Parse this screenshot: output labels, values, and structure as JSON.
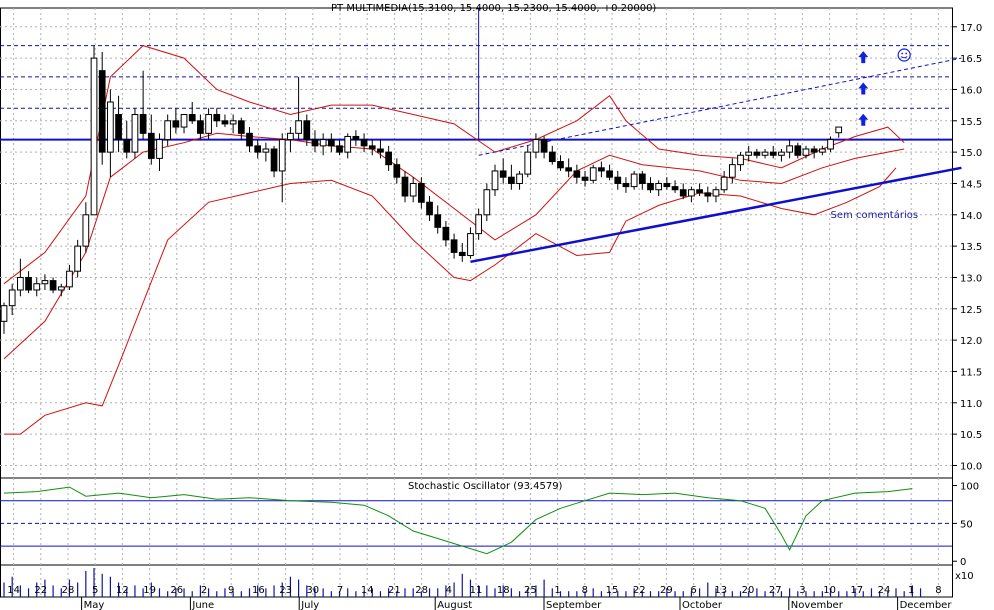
{
  "chart_data": {
    "type": "candlestick",
    "title": "PT MULTIMEDIA(15.3100, 15.4000, 15.2300, 15.4000, +0.20000)",
    "price_axis": {
      "ylim": [
        9.8,
        17.3
      ],
      "ticks": [
        10.0,
        10.5,
        11.0,
        11.5,
        12.0,
        12.5,
        13.0,
        13.5,
        14.0,
        14.5,
        15.0,
        15.5,
        16.0,
        16.5,
        17.0
      ],
      "tick_labels": [
        "10.0",
        "10.5",
        "11.0",
        "11.5",
        "12.0",
        "12.5",
        "13.0",
        "13.5",
        "14.0",
        "14.5",
        "15.0",
        "15.5",
        "16.0",
        "16.5",
        "17.0"
      ],
      "grid": true
    },
    "x_axis": {
      "day_labels": [
        "14",
        "22",
        "28",
        "5",
        "12",
        "19",
        "26",
        "2",
        "9",
        "16",
        "23",
        "30",
        "7",
        "14",
        "21",
        "28",
        "4",
        "11",
        "18",
        "25",
        "1",
        "8",
        "15",
        "22",
        "29",
        "6",
        "13",
        "20",
        "27",
        "3",
        "10",
        "17",
        "24",
        "1",
        "8"
      ],
      "month_labels": [
        {
          "label": "May",
          "at": 3
        },
        {
          "label": "June",
          "at": 7
        },
        {
          "label": "July",
          "at": 11
        },
        {
          "label": "August",
          "at": 16
        },
        {
          "label": "September",
          "at": 20
        },
        {
          "label": "October",
          "at": 25
        },
        {
          "label": "November",
          "at": 29
        },
        {
          "label": "December",
          "at": 33
        }
      ]
    },
    "candles": [
      {
        "o": 12.3,
        "h": 12.6,
        "l": 12.1,
        "c": 12.55
      },
      {
        "o": 12.55,
        "h": 12.9,
        "l": 12.4,
        "c": 12.8
      },
      {
        "o": 12.8,
        "h": 13.3,
        "l": 12.7,
        "c": 13.0
      },
      {
        "o": 13.0,
        "h": 13.1,
        "l": 12.75,
        "c": 12.8
      },
      {
        "o": 12.8,
        "h": 13.0,
        "l": 12.7,
        "c": 12.9
      },
      {
        "o": 12.9,
        "h": 13.05,
        "l": 12.8,
        "c": 12.95
      },
      {
        "o": 12.95,
        "h": 13.0,
        "l": 12.75,
        "c": 12.8
      },
      {
        "o": 12.8,
        "h": 12.9,
        "l": 12.7,
        "c": 12.85
      },
      {
        "o": 12.85,
        "h": 13.2,
        "l": 12.8,
        "c": 13.1
      },
      {
        "o": 13.1,
        "h": 13.6,
        "l": 13.0,
        "c": 13.5
      },
      {
        "o": 13.5,
        "h": 14.2,
        "l": 13.4,
        "c": 14.0
      },
      {
        "o": 14.0,
        "h": 16.7,
        "l": 14.0,
        "c": 16.5
      },
      {
        "o": 16.3,
        "h": 16.6,
        "l": 14.8,
        "c": 15.0
      },
      {
        "o": 15.0,
        "h": 16.0,
        "l": 14.6,
        "c": 15.8
      },
      {
        "o": 15.6,
        "h": 15.9,
        "l": 15.0,
        "c": 15.2
      },
      {
        "o": 15.2,
        "h": 15.5,
        "l": 14.9,
        "c": 15.0
      },
      {
        "o": 15.0,
        "h": 15.7,
        "l": 14.9,
        "c": 15.6
      },
      {
        "o": 15.6,
        "h": 16.3,
        "l": 15.2,
        "c": 15.3
      },
      {
        "o": 15.3,
        "h": 15.6,
        "l": 14.8,
        "c": 14.9
      },
      {
        "o": 14.9,
        "h": 15.3,
        "l": 14.7,
        "c": 15.2
      },
      {
        "o": 15.2,
        "h": 15.6,
        "l": 15.1,
        "c": 15.5
      },
      {
        "o": 15.5,
        "h": 15.7,
        "l": 15.3,
        "c": 15.4
      },
      {
        "o": 15.4,
        "h": 15.6,
        "l": 15.3,
        "c": 15.6
      },
      {
        "o": 15.6,
        "h": 15.8,
        "l": 15.45,
        "c": 15.5
      },
      {
        "o": 15.5,
        "h": 15.6,
        "l": 15.2,
        "c": 15.3
      },
      {
        "o": 15.3,
        "h": 15.7,
        "l": 15.2,
        "c": 15.6
      },
      {
        "o": 15.6,
        "h": 15.7,
        "l": 15.4,
        "c": 15.5
      },
      {
        "o": 15.5,
        "h": 15.6,
        "l": 15.4,
        "c": 15.45
      },
      {
        "o": 15.45,
        "h": 15.6,
        "l": 15.3,
        "c": 15.5
      },
      {
        "o": 15.5,
        "h": 15.55,
        "l": 15.2,
        "c": 15.3
      },
      {
        "o": 15.3,
        "h": 15.4,
        "l": 15.0,
        "c": 15.1
      },
      {
        "o": 15.1,
        "h": 15.2,
        "l": 14.9,
        "c": 15.0
      },
      {
        "o": 15.0,
        "h": 15.15,
        "l": 14.85,
        "c": 15.05
      },
      {
        "o": 15.05,
        "h": 15.1,
        "l": 14.6,
        "c": 14.7
      },
      {
        "o": 14.7,
        "h": 15.3,
        "l": 14.2,
        "c": 15.2
      },
      {
        "o": 15.2,
        "h": 15.4,
        "l": 15.0,
        "c": 15.3
      },
      {
        "o": 15.3,
        "h": 16.2,
        "l": 15.2,
        "c": 15.5
      },
      {
        "o": 15.5,
        "h": 15.6,
        "l": 15.1,
        "c": 15.2
      },
      {
        "o": 15.2,
        "h": 15.35,
        "l": 15.0,
        "c": 15.1
      },
      {
        "o": 15.1,
        "h": 15.3,
        "l": 14.95,
        "c": 15.2
      },
      {
        "o": 15.2,
        "h": 15.3,
        "l": 15.0,
        "c": 15.1
      },
      {
        "o": 15.1,
        "h": 15.2,
        "l": 14.95,
        "c": 15.0
      },
      {
        "o": 15.0,
        "h": 15.3,
        "l": 14.9,
        "c": 15.25
      },
      {
        "o": 15.25,
        "h": 15.35,
        "l": 15.1,
        "c": 15.2
      },
      {
        "o": 15.2,
        "h": 15.3,
        "l": 15.0,
        "c": 15.1
      },
      {
        "o": 15.1,
        "h": 15.2,
        "l": 14.95,
        "c": 15.05
      },
      {
        "o": 15.05,
        "h": 15.2,
        "l": 14.9,
        "c": 15.0
      },
      {
        "o": 15.0,
        "h": 15.1,
        "l": 14.7,
        "c": 14.8
      },
      {
        "o": 14.8,
        "h": 14.9,
        "l": 14.5,
        "c": 14.6
      },
      {
        "o": 14.6,
        "h": 14.7,
        "l": 14.2,
        "c": 14.3
      },
      {
        "o": 14.3,
        "h": 14.6,
        "l": 14.2,
        "c": 14.5
      },
      {
        "o": 14.5,
        "h": 14.6,
        "l": 14.1,
        "c": 14.2
      },
      {
        "o": 14.2,
        "h": 14.3,
        "l": 13.9,
        "c": 14.0
      },
      {
        "o": 14.0,
        "h": 14.15,
        "l": 13.7,
        "c": 13.8
      },
      {
        "o": 13.8,
        "h": 13.9,
        "l": 13.5,
        "c": 13.6
      },
      {
        "o": 13.6,
        "h": 13.7,
        "l": 13.3,
        "c": 13.4
      },
      {
        "o": 13.4,
        "h": 13.55,
        "l": 13.25,
        "c": 13.35
      },
      {
        "o": 13.35,
        "h": 13.8,
        "l": 13.3,
        "c": 13.7
      },
      {
        "o": 13.7,
        "h": 14.1,
        "l": 13.6,
        "c": 14.0
      },
      {
        "o": 14.0,
        "h": 14.5,
        "l": 13.9,
        "c": 14.4
      },
      {
        "o": 14.4,
        "h": 14.8,
        "l": 14.3,
        "c": 14.7
      },
      {
        "o": 14.7,
        "h": 14.9,
        "l": 14.5,
        "c": 14.6
      },
      {
        "o": 14.6,
        "h": 14.8,
        "l": 14.4,
        "c": 14.5
      },
      {
        "o": 14.5,
        "h": 14.7,
        "l": 14.4,
        "c": 14.65
      },
      {
        "o": 14.65,
        "h": 15.1,
        "l": 14.6,
        "c": 15.0
      },
      {
        "o": 15.0,
        "h": 15.3,
        "l": 14.9,
        "c": 15.2
      },
      {
        "o": 15.2,
        "h": 15.25,
        "l": 14.9,
        "c": 15.0
      },
      {
        "o": 15.0,
        "h": 15.1,
        "l": 14.8,
        "c": 14.85
      },
      {
        "o": 14.85,
        "h": 14.95,
        "l": 14.7,
        "c": 14.75
      },
      {
        "o": 14.75,
        "h": 14.9,
        "l": 14.6,
        "c": 14.7
      },
      {
        "o": 14.7,
        "h": 14.8,
        "l": 14.5,
        "c": 14.6
      },
      {
        "o": 14.6,
        "h": 14.7,
        "l": 14.45,
        "c": 14.55
      },
      {
        "o": 14.55,
        "h": 14.8,
        "l": 14.5,
        "c": 14.75
      },
      {
        "o": 14.75,
        "h": 14.85,
        "l": 14.6,
        "c": 14.7
      },
      {
        "o": 14.7,
        "h": 14.8,
        "l": 14.55,
        "c": 14.6
      },
      {
        "o": 14.6,
        "h": 14.7,
        "l": 14.4,
        "c": 14.5
      },
      {
        "o": 14.5,
        "h": 14.6,
        "l": 14.35,
        "c": 14.45
      },
      {
        "o": 14.45,
        "h": 14.7,
        "l": 14.4,
        "c": 14.65
      },
      {
        "o": 14.65,
        "h": 14.7,
        "l": 14.4,
        "c": 14.5
      },
      {
        "o": 14.5,
        "h": 14.6,
        "l": 14.35,
        "c": 14.4
      },
      {
        "o": 14.4,
        "h": 14.55,
        "l": 14.3,
        "c": 14.5
      },
      {
        "o": 14.5,
        "h": 14.6,
        "l": 14.4,
        "c": 14.45
      },
      {
        "o": 14.45,
        "h": 14.55,
        "l": 14.35,
        "c": 14.4
      },
      {
        "o": 14.4,
        "h": 14.5,
        "l": 14.25,
        "c": 14.3
      },
      {
        "o": 14.3,
        "h": 14.45,
        "l": 14.2,
        "c": 14.4
      },
      {
        "o": 14.4,
        "h": 14.5,
        "l": 14.3,
        "c": 14.35
      },
      {
        "o": 14.35,
        "h": 14.45,
        "l": 14.2,
        "c": 14.3
      },
      {
        "o": 14.3,
        "h": 14.45,
        "l": 14.2,
        "c": 14.4
      },
      {
        "o": 14.4,
        "h": 14.7,
        "l": 14.35,
        "c": 14.6
      },
      {
        "o": 14.6,
        "h": 14.9,
        "l": 14.5,
        "c": 14.8
      },
      {
        "o": 14.8,
        "h": 15.0,
        "l": 14.7,
        "c": 14.95
      },
      {
        "o": 14.95,
        "h": 15.1,
        "l": 14.85,
        "c": 15.0
      },
      {
        "o": 15.0,
        "h": 15.05,
        "l": 14.9,
        "c": 14.95
      },
      {
        "o": 14.95,
        "h": 15.05,
        "l": 14.9,
        "c": 15.0
      },
      {
        "o": 15.0,
        "h": 15.1,
        "l": 14.9,
        "c": 14.95
      },
      {
        "o": 14.95,
        "h": 15.05,
        "l": 14.85,
        "c": 15.0
      },
      {
        "o": 15.0,
        "h": 15.2,
        "l": 14.9,
        "c": 15.1
      },
      {
        "o": 15.1,
        "h": 15.15,
        "l": 14.9,
        "c": 14.95
      },
      {
        "o": 14.95,
        "h": 15.1,
        "l": 14.9,
        "c": 15.05
      },
      {
        "o": 15.05,
        "h": 15.1,
        "l": 14.9,
        "c": 15.0
      },
      {
        "o": 15.0,
        "h": 15.1,
        "l": 14.95,
        "c": 15.05
      },
      {
        "o": 15.05,
        "h": 15.25,
        "l": 15.0,
        "c": 15.2
      },
      {
        "o": 15.31,
        "h": 15.4,
        "l": 15.23,
        "c": 15.4
      }
    ],
    "bollinger_bands": {
      "upper": [
        [
          0,
          12.9
        ],
        [
          5,
          13.4
        ],
        [
          10,
          14.3
        ],
        [
          13,
          16.2
        ],
        [
          17,
          16.7
        ],
        [
          22,
          16.5
        ],
        [
          26,
          16.0
        ],
        [
          30,
          15.8
        ],
        [
          35,
          15.6
        ],
        [
          40,
          15.75
        ],
        [
          45,
          15.75
        ],
        [
          50,
          15.6
        ],
        [
          55,
          15.45
        ],
        [
          60,
          15.0
        ],
        [
          65,
          15.2
        ],
        [
          70,
          15.5
        ],
        [
          74,
          15.9
        ],
        [
          76,
          15.5
        ],
        [
          80,
          15.05
        ],
        [
          85,
          14.95
        ],
        [
          90,
          14.9
        ],
        [
          95,
          14.75
        ],
        [
          100,
          15.05
        ],
        [
          104,
          15.25
        ],
        [
          108,
          15.4
        ],
        [
          110,
          15.15
        ]
      ],
      "middle": [
        [
          0,
          11.7
        ],
        [
          5,
          12.3
        ],
        [
          10,
          13.4
        ],
        [
          13,
          14.6
        ],
        [
          17,
          15.0
        ],
        [
          22,
          15.15
        ],
        [
          26,
          15.3
        ],
        [
          30,
          15.25
        ],
        [
          35,
          15.2
        ],
        [
          40,
          15.1
        ],
        [
          45,
          15.05
        ],
        [
          50,
          14.6
        ],
        [
          55,
          14.1
        ],
        [
          60,
          13.6
        ],
        [
          65,
          14.0
        ],
        [
          70,
          14.7
        ],
        [
          74,
          14.95
        ],
        [
          78,
          14.8
        ],
        [
          85,
          14.7
        ],
        [
          90,
          14.55
        ],
        [
          95,
          14.5
        ],
        [
          100,
          14.75
        ],
        [
          104,
          14.9
        ],
        [
          108,
          15.0
        ],
        [
          110,
          15.05
        ]
      ],
      "lower": [
        [
          0,
          10.5
        ],
        [
          2,
          10.5
        ],
        [
          5,
          10.8
        ],
        [
          10,
          11.0
        ],
        [
          12,
          10.95
        ],
        [
          14,
          11.6
        ],
        [
          20,
          13.6
        ],
        [
          25,
          14.2
        ],
        [
          30,
          14.35
        ],
        [
          35,
          14.5
        ],
        [
          40,
          14.55
        ],
        [
          45,
          14.3
        ],
        [
          50,
          13.6
        ],
        [
          55,
          13.0
        ],
        [
          57,
          12.95
        ],
        [
          60,
          13.2
        ],
        [
          65,
          13.7
        ],
        [
          70,
          13.35
        ],
        [
          74,
          13.4
        ],
        [
          76,
          13.9
        ],
        [
          80,
          14.15
        ],
        [
          85,
          14.35
        ],
        [
          90,
          14.3
        ],
        [
          95,
          14.1
        ],
        [
          99,
          14.0
        ],
        [
          103,
          14.2
        ],
        [
          107,
          14.45
        ],
        [
          109,
          14.75
        ]
      ]
    },
    "reference_lines": {
      "solid_resistance": 15.2,
      "dashed_levels": [
        16.7,
        16.2,
        15.7
      ]
    },
    "trendlines": [
      {
        "style": "solid",
        "from": [
          57,
          13.25
        ],
        "to": [
          117,
          14.75
        ]
      },
      {
        "style": "dashed",
        "from": [
          58,
          14.95
        ],
        "to": [
          117,
          16.5
        ]
      }
    ],
    "markers": {
      "arrows_at": [
        [
          105,
          15.5
        ],
        [
          105,
          16.0
        ],
        [
          105,
          16.5
        ]
      ],
      "smiley_at": [
        110,
        16.55
      ],
      "vertical_marker": {
        "at": 58,
        "from": 15.2,
        "to": 17.3
      }
    },
    "annotation": {
      "text": "Sem comentários",
      "at": [
        101,
        14.0
      ]
    },
    "stochastic": {
      "label": "Stochastic Oscillator (93.4579)",
      "ylim": [
        -5,
        110
      ],
      "ticks": [
        0,
        50,
        100
      ],
      "tick_labels": [
        "0",
        "50",
        "100"
      ],
      "levels": [
        20,
        50,
        80
      ],
      "values": [
        [
          0,
          90
        ],
        [
          4,
          92
        ],
        [
          8,
          98
        ],
        [
          10,
          86
        ],
        [
          14,
          90
        ],
        [
          18,
          84
        ],
        [
          22,
          88
        ],
        [
          26,
          82
        ],
        [
          30,
          84
        ],
        [
          35,
          80
        ],
        [
          40,
          78
        ],
        [
          44,
          74
        ],
        [
          47,
          60
        ],
        [
          50,
          40
        ],
        [
          53,
          30
        ],
        [
          56,
          20
        ],
        [
          59,
          10
        ],
        [
          62,
          25
        ],
        [
          65,
          55
        ],
        [
          68,
          70
        ],
        [
          71,
          80
        ],
        [
          74,
          90
        ],
        [
          78,
          88
        ],
        [
          82,
          90
        ],
        [
          86,
          84
        ],
        [
          90,
          80
        ],
        [
          93,
          70
        ],
        [
          95,
          35
        ],
        [
          96,
          15
        ],
        [
          98,
          60
        ],
        [
          100,
          80
        ],
        [
          104,
          90
        ],
        [
          108,
          92
        ],
        [
          111,
          96
        ]
      ]
    },
    "volume": {
      "axis_label": "x10",
      "bars": [
        0.5,
        0.7,
        0.4,
        0.3,
        0.5,
        0.6,
        0.4,
        0.3,
        0.6,
        0.5,
        0.9,
        1.0,
        0.8,
        0.7,
        0.5,
        0.3,
        0.4,
        0.3,
        0.5,
        0.3,
        0.2,
        0.3,
        0.3,
        0.2,
        0.4,
        0.3,
        0.2,
        0.3,
        0.2,
        0.2,
        0.3,
        0.4,
        0.3,
        0.4,
        0.5,
        0.7,
        0.6,
        0.4,
        0.3,
        0.3,
        0.2,
        0.2,
        0.3,
        0.2,
        0.2,
        0.3,
        0.2,
        0.3,
        0.2,
        0.3,
        0.3,
        0.2,
        0.3,
        0.3,
        0.4,
        0.5,
        0.8,
        0.6,
        0.4,
        0.4,
        0.3,
        0.4,
        0.3,
        0.2,
        0.3,
        0.4,
        0.6,
        0.3,
        0.2,
        0.2,
        0.2,
        0.2,
        0.3,
        0.2,
        0.2,
        0.2,
        0.2,
        0.3,
        0.2,
        0.2,
        0.2,
        0.3,
        0.2,
        0.2,
        0.2,
        0.3,
        0.5,
        0.3,
        0.2,
        0.2,
        0.2,
        0.2,
        0.3,
        0.2,
        0.2,
        0.2,
        0.3,
        0.2,
        0.2,
        0.2,
        0.2,
        0.3,
        0.2,
        0.2,
        0.3,
        0.2,
        0.3,
        0.2,
        0.2,
        0.3,
        0.2,
        0.4,
        0.3
      ]
    }
  }
}
